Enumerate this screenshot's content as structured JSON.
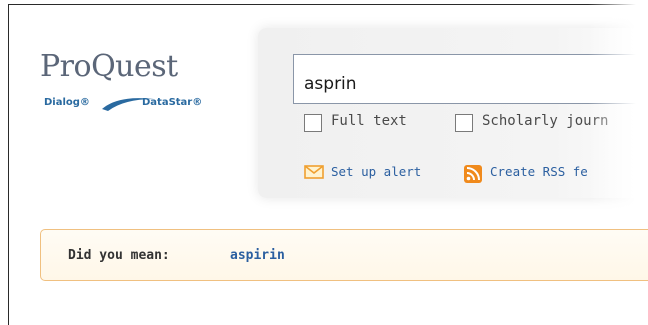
{
  "logo": {
    "wordmark": "ProQuest",
    "sub_left": "Dialog®",
    "sub_right": "DataStar®"
  },
  "search": {
    "query": "asprin",
    "options": [
      {
        "label": "Full text",
        "checked": false
      },
      {
        "label": "Scholarly journ",
        "checked": false
      }
    ],
    "links": [
      {
        "label": "Set up alert",
        "icon": "envelope-icon"
      },
      {
        "label": "Create RSS fe",
        "icon": "rss-icon"
      }
    ]
  },
  "suggestion": {
    "prefix": "Did you mean:",
    "term": "aspirin"
  },
  "colors": {
    "link": "#2b5fa0",
    "suggestion_border": "#f0c080",
    "rss": "#f08a1c",
    "envelope": "#f0a030"
  }
}
